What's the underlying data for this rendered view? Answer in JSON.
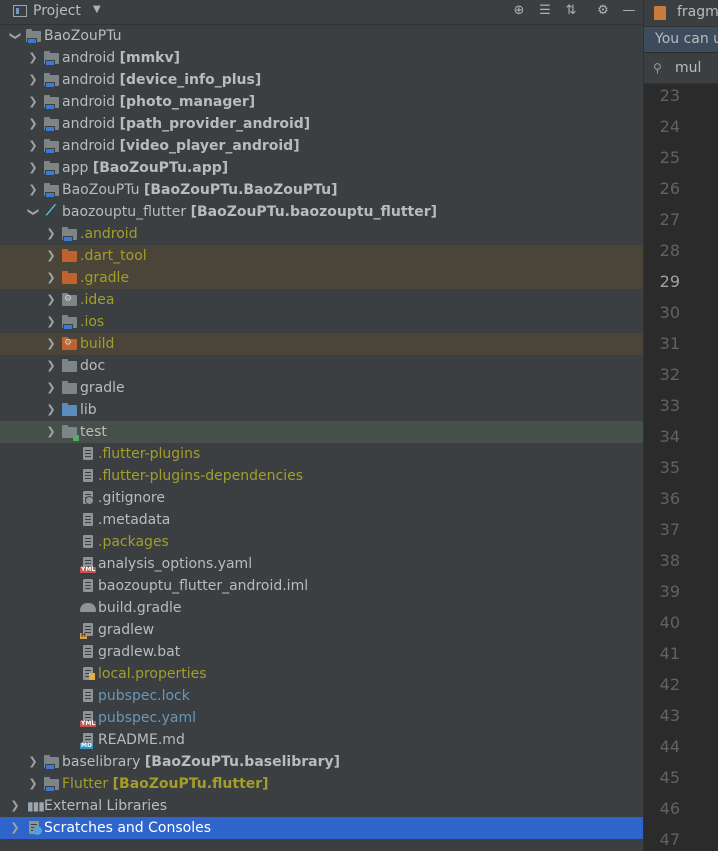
{
  "header": {
    "title": "Project"
  },
  "tree": [
    {
      "depth": 0,
      "arrow": "open",
      "icon": "module",
      "label": "BaoZouPTu",
      "module": "",
      "style": "normal",
      "hl": ""
    },
    {
      "depth": 1,
      "arrow": "closed",
      "icon": "folder-gray-mod",
      "label": "android ",
      "module": "[mmkv]",
      "style": "normal",
      "hl": ""
    },
    {
      "depth": 1,
      "arrow": "closed",
      "icon": "folder-gray-mod",
      "label": "android ",
      "module": "[device_info_plus]",
      "style": "normal",
      "hl": ""
    },
    {
      "depth": 1,
      "arrow": "closed",
      "icon": "folder-gray-mod",
      "label": "android ",
      "module": "[photo_manager]",
      "style": "normal",
      "hl": ""
    },
    {
      "depth": 1,
      "arrow": "closed",
      "icon": "folder-gray-mod",
      "label": "android ",
      "module": "[path_provider_android]",
      "style": "normal",
      "hl": ""
    },
    {
      "depth": 1,
      "arrow": "closed",
      "icon": "folder-gray-mod",
      "label": "android ",
      "module": "[video_player_android]",
      "style": "normal",
      "hl": ""
    },
    {
      "depth": 1,
      "arrow": "closed",
      "icon": "folder-gray-mod",
      "label": "app ",
      "module": "[BaoZouPTu.app]",
      "style": "normal",
      "hl": ""
    },
    {
      "depth": 1,
      "arrow": "closed",
      "icon": "folder-gray-mod",
      "label": "BaoZouPTu ",
      "module": "[BaoZouPTu.BaoZouPTu]",
      "style": "normal",
      "hl": ""
    },
    {
      "depth": 1,
      "arrow": "open",
      "icon": "flutter",
      "label": "baozouptu_flutter ",
      "module": "[BaoZouPTu.baozouptu_flutter]",
      "style": "normal",
      "hl": ""
    },
    {
      "depth": 2,
      "arrow": "closed",
      "icon": "folder-gray-mod",
      "label": ".android",
      "module": "",
      "style": "olive",
      "hl": ""
    },
    {
      "depth": 2,
      "arrow": "closed",
      "icon": "folder-orange",
      "label": ".dart_tool",
      "module": "",
      "style": "olive",
      "hl": "orange"
    },
    {
      "depth": 2,
      "arrow": "closed",
      "icon": "folder-orange",
      "label": ".gradle",
      "module": "",
      "style": "olive",
      "hl": "orange"
    },
    {
      "depth": 2,
      "arrow": "closed",
      "icon": "folder-gray-gear",
      "label": ".idea",
      "module": "",
      "style": "olive",
      "hl": ""
    },
    {
      "depth": 2,
      "arrow": "closed",
      "icon": "folder-gray-mod",
      "label": ".ios",
      "module": "",
      "style": "olive",
      "hl": ""
    },
    {
      "depth": 2,
      "arrow": "closed",
      "icon": "folder-orange-gear",
      "label": "build",
      "module": "",
      "style": "olive",
      "hl": "orange"
    },
    {
      "depth": 2,
      "arrow": "closed",
      "icon": "folder-gray",
      "label": "doc",
      "module": "",
      "style": "normal",
      "hl": ""
    },
    {
      "depth": 2,
      "arrow": "closed",
      "icon": "folder-gray",
      "label": "gradle",
      "module": "",
      "style": "normal",
      "hl": ""
    },
    {
      "depth": 2,
      "arrow": "closed",
      "icon": "folder-blue",
      "label": "lib",
      "module": "",
      "style": "normal",
      "hl": ""
    },
    {
      "depth": 2,
      "arrow": "closed",
      "icon": "folder-test",
      "label": "test",
      "module": "",
      "style": "normal",
      "hl": "green"
    },
    {
      "depth": 3,
      "arrow": "",
      "icon": "file",
      "label": ".flutter-plugins",
      "module": "",
      "style": "olive",
      "hl": ""
    },
    {
      "depth": 3,
      "arrow": "",
      "icon": "file",
      "label": ".flutter-plugins-dependencies",
      "module": "",
      "style": "olive",
      "hl": ""
    },
    {
      "depth": 3,
      "arrow": "",
      "icon": "file-ignore",
      "label": ".gitignore",
      "module": "",
      "style": "normal",
      "hl": ""
    },
    {
      "depth": 3,
      "arrow": "",
      "icon": "file",
      "label": ".metadata",
      "module": "",
      "style": "normal",
      "hl": ""
    },
    {
      "depth": 3,
      "arrow": "",
      "icon": "file",
      "label": ".packages",
      "module": "",
      "style": "olive",
      "hl": ""
    },
    {
      "depth": 3,
      "arrow": "",
      "icon": "file-yml",
      "label": "analysis_options.yaml",
      "module": "",
      "style": "normal",
      "hl": ""
    },
    {
      "depth": 3,
      "arrow": "",
      "icon": "file-iml",
      "label": "baozouptu_flutter_android.iml",
      "module": "",
      "style": "normal",
      "hl": ""
    },
    {
      "depth": 3,
      "arrow": "",
      "icon": "file-gradle",
      "label": "build.gradle",
      "module": "",
      "style": "normal",
      "hl": ""
    },
    {
      "depth": 3,
      "arrow": "",
      "icon": "file-h",
      "label": "gradlew",
      "module": "",
      "style": "normal",
      "hl": ""
    },
    {
      "depth": 3,
      "arrow": "",
      "icon": "file",
      "label": "gradlew.bat",
      "module": "",
      "style": "normal",
      "hl": ""
    },
    {
      "depth": 3,
      "arrow": "",
      "icon": "file-props",
      "label": "local.properties",
      "module": "",
      "style": "olive",
      "hl": ""
    },
    {
      "depth": 3,
      "arrow": "",
      "icon": "file",
      "label": "pubspec.lock",
      "module": "",
      "style": "blue",
      "hl": ""
    },
    {
      "depth": 3,
      "arrow": "",
      "icon": "file-yml",
      "label": "pubspec.yaml",
      "module": "",
      "style": "blue",
      "hl": ""
    },
    {
      "depth": 3,
      "arrow": "",
      "icon": "file-md",
      "label": "README.md",
      "module": "",
      "style": "normal",
      "hl": ""
    },
    {
      "depth": 1,
      "arrow": "closed",
      "icon": "folder-gray-mod",
      "label": "baselibrary ",
      "module": "[BaoZouPTu.baselibrary]",
      "style": "normal",
      "hl": ""
    },
    {
      "depth": 1,
      "arrow": "closed",
      "icon": "folder-gray-mod",
      "label": "Flutter ",
      "module": "[BaoZouPTu.flutter]",
      "style": "olive",
      "hl": ""
    },
    {
      "depth": 0,
      "arrow": "closed",
      "icon": "libraries",
      "label": "External Libraries",
      "module": "",
      "style": "normal",
      "hl": ""
    },
    {
      "depth": 0,
      "arrow": "closed",
      "icon": "scratches",
      "label": "Scratches and Consoles",
      "module": "",
      "style": "normal",
      "hl": "selected"
    }
  ],
  "editor": {
    "tab_label": "fragm",
    "notice": "You can u",
    "search_text": "mul",
    "line_numbers": [
      "23",
      "24",
      "25",
      "26",
      "27",
      "28",
      "29",
      "30",
      "31",
      "32",
      "33",
      "34",
      "35",
      "36",
      "37",
      "38",
      "39",
      "40",
      "41",
      "42",
      "43",
      "44",
      "45",
      "46",
      "47"
    ],
    "current_line": "29"
  }
}
